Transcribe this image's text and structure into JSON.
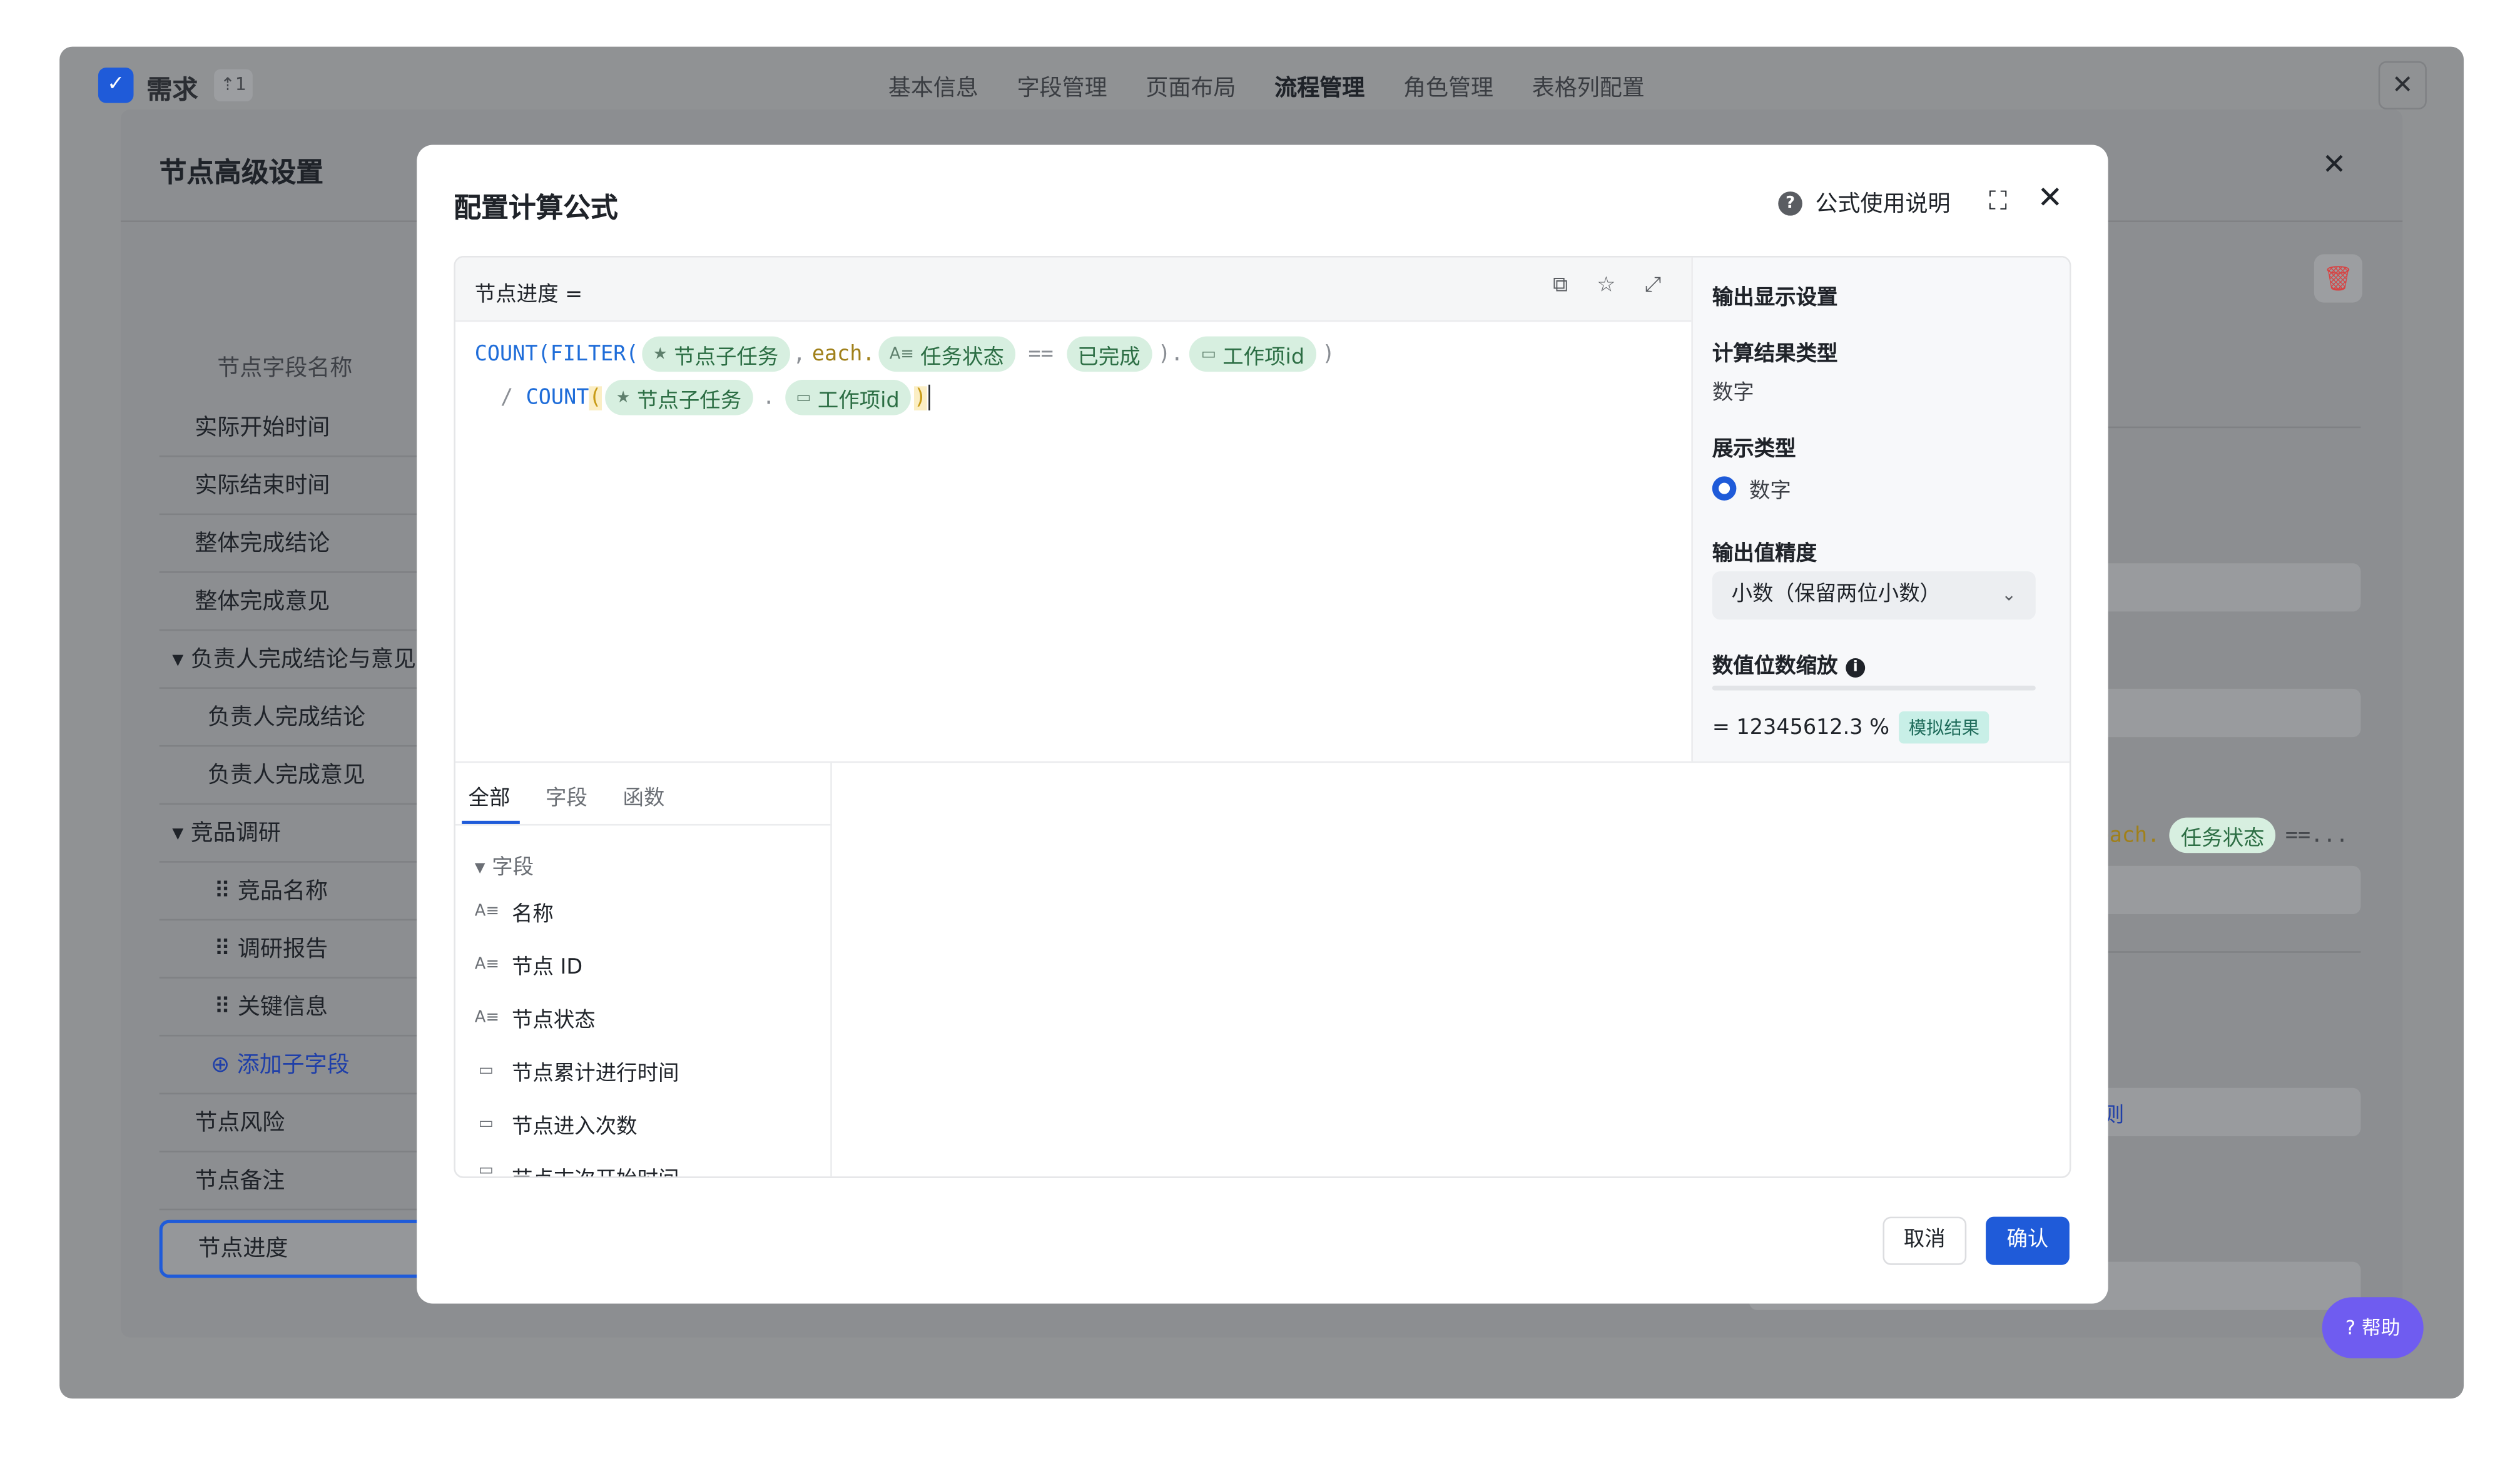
{
  "app": {
    "logo_glyph": "✓",
    "name": "需求",
    "pin_label": "⇡1",
    "tabs": [
      {
        "label": "基本信息"
      },
      {
        "label": "字段管理"
      },
      {
        "label": "页面布局"
      },
      {
        "label": "流程管理"
      },
      {
        "label": "角色管理"
      },
      {
        "label": "表格列配置"
      }
    ],
    "active_tab": "流程管理",
    "close_glyph": "✕"
  },
  "panel": {
    "title": "节点高级设置",
    "close_glyph": "✕",
    "sidebar_header": "节点字段名称",
    "items": [
      {
        "label": "实际开始时间"
      },
      {
        "label": "实际结束时间"
      },
      {
        "label": "整体完成结论"
      },
      {
        "label": "整体完成意见"
      },
      {
        "label": "▾ 负责人完成结论与意见"
      },
      {
        "label": "负责人完成结论"
      },
      {
        "label": "负责人完成意见"
      },
      {
        "label": "▾ 竞品调研"
      },
      {
        "label": "⠿  竞品名称"
      },
      {
        "label": "⠿  调研报告"
      },
      {
        "label": "⠿  关键信息"
      },
      {
        "label": "⊕ 添加子字段"
      },
      {
        "label": "节点风险"
      },
      {
        "label": "节点备注"
      },
      {
        "label": "节点进度"
      }
    ],
    "delete_glyph": "🗑",
    "partial_each": "each.",
    "partial_chip": "任务状态",
    "partial_eq": "==...",
    "partial_rule": "则"
  },
  "modal": {
    "title": "配置计算公式",
    "help_icon_glyph": "?",
    "help_label": "公式使用说明",
    "fullscreen_glyph": "⛶",
    "close_glyph": "✕",
    "editor": {
      "label": "节点进度 =",
      "icon_copy": "⧉",
      "icon_fav": "☆",
      "icon_expand": "⤢",
      "line1": {
        "fn1": "COUNT(",
        "fn2": "FILTER(",
        "chip1": "节点子任务",
        "sep": ",",
        "each": "each.",
        "chip2": "任务状态",
        "eq": "==",
        "chip3": "已完成",
        "close": ").",
        "chip4": "工作项id",
        "end": ")"
      },
      "line2": {
        "div": "/",
        "fn": "COUNT",
        "open": "(",
        "chip1": "节点子任务",
        "dot": ".",
        "chip2": "工作项id",
        "close": ")"
      }
    },
    "output": {
      "title": "输出显示设置",
      "result_type_label": "计算结果类型",
      "result_type_value": "数字",
      "display_type_label": "展示类型",
      "display_type_option": "数字",
      "precision_label": "输出值精度",
      "precision_value": "小数（保留两位小数）",
      "scale_label": "数值位数缩放",
      "result_text": "= 12345612.3 %",
      "result_badge": "模拟结果"
    },
    "library": {
      "tabs": [
        {
          "label": "全部"
        },
        {
          "label": "字段"
        },
        {
          "label": "函数"
        }
      ],
      "active_tab": "全部",
      "group_label": "▾  字段",
      "fields": [
        {
          "label": "名称",
          "icon": "A≡"
        },
        {
          "label": "节点 ID",
          "icon": "A≡"
        },
        {
          "label": "节点状态",
          "icon": "A≡"
        },
        {
          "label": "节点累计进行时间",
          "icon": "▭"
        },
        {
          "label": "节点进入次数",
          "icon": "▭"
        },
        {
          "label": "节点末次开始时间",
          "icon": "▭"
        }
      ]
    },
    "cancel_label": "取消",
    "confirm_label": "确认"
  },
  "help_button": "? 帮助"
}
